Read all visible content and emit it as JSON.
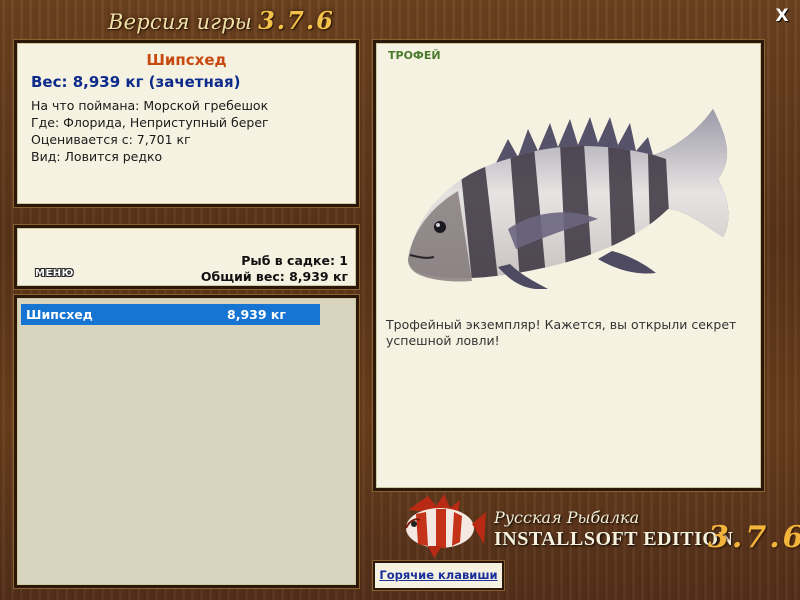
{
  "window": {
    "title": "Версия игры",
    "version": "3.7.6",
    "close_label": "X"
  },
  "fish_info": {
    "name": "Шипсхед",
    "weight": "Вес: 8,939 кг (зачетная)",
    "lines": [
      "На что поймана: Морской гребешок",
      "Где: Флорида, Неприступный берег",
      "Оценивается с: 7,701 кг",
      "Вид: Ловится редко"
    ]
  },
  "keepnet": {
    "menu_label": "МЕНЮ",
    "count_text": "Рыб в садке: 1",
    "total_weight_text": "Общий вес: 8,939 кг"
  },
  "catch_list": {
    "items": [
      {
        "name": "Шипсхед",
        "weight": "8,939 кг"
      }
    ]
  },
  "picture": {
    "label": "ТРОФЕЙ",
    "description": "Трофейный экземпляр! Кажется, вы открыли секрет успешной ловли!"
  },
  "logo": {
    "line1": "Русская Рыбалка",
    "line2": "INSTALLSOFT EDITION",
    "version": "3.7.6"
  },
  "hotkeys": {
    "label": "Горячие клавиши"
  },
  "colors": {
    "accent_orange": "#c84a10",
    "weight_blue": "#0d2b8a",
    "selection_blue": "#1674d2",
    "trophy_green": "#4a7a2e",
    "gold": "#f2b43a"
  }
}
